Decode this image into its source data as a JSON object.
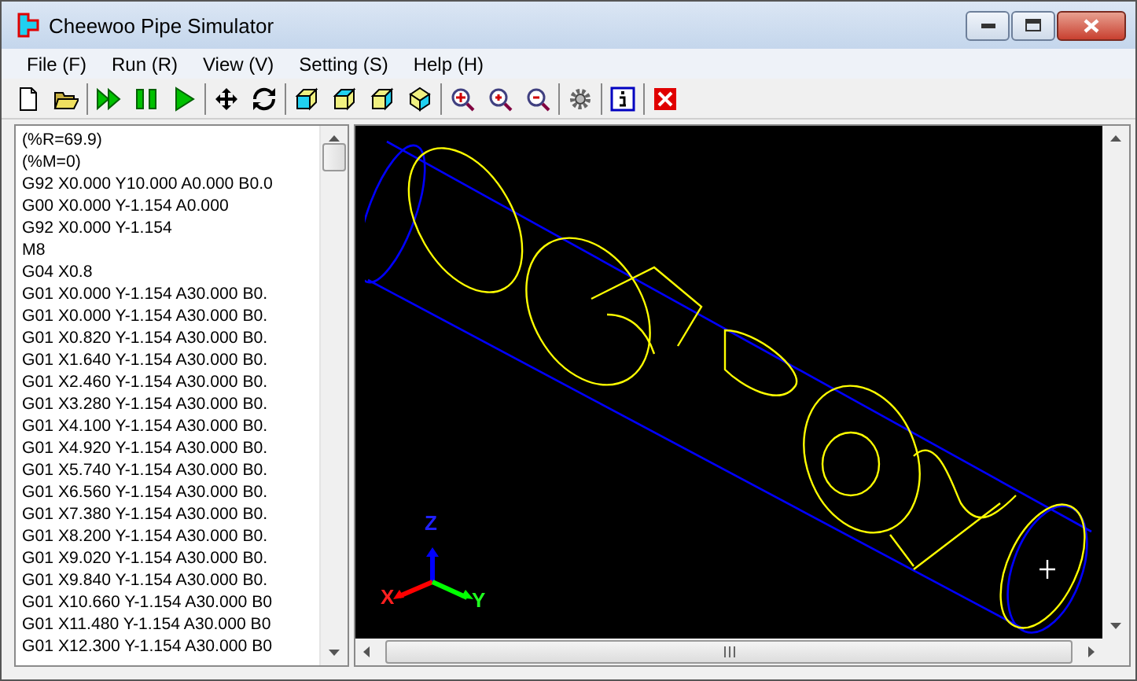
{
  "window": {
    "title": "Cheewoo Pipe Simulator"
  },
  "menu": [
    "File (F)",
    "Run (R)",
    "View (V)",
    "Setting (S)",
    "Help (H)"
  ],
  "code_lines": [
    "(%R=69.9)",
    "(%M=0)",
    "G92 X0.000 Y10.000 A0.000 B0.0",
    "G00 X0.000 Y-1.154 A0.000",
    "G92 X0.000 Y-1.154",
    "M8",
    "G04 X0.8",
    "G01 X0.000 Y-1.154 A30.000 B0.",
    "G01 X0.000 Y-1.154 A30.000 B0.",
    "G01 X0.820 Y-1.154 A30.000 B0.",
    "G01 X1.640 Y-1.154 A30.000 B0.",
    "G01 X2.460 Y-1.154 A30.000 B0.",
    "G01 X3.280 Y-1.154 A30.000 B0.",
    "G01 X4.100 Y-1.154 A30.000 B0.",
    "G01 X4.920 Y-1.154 A30.000 B0.",
    "G01 X5.740 Y-1.154 A30.000 B0.",
    "G01 X6.560 Y-1.154 A30.000 B0.",
    "G01 X7.380 Y-1.154 A30.000 B0.",
    "G01 X8.200 Y-1.154 A30.000 B0.",
    "G01 X9.020 Y-1.154 A30.000 B0.",
    "G01 X9.840 Y-1.154 A30.000 B0.",
    "G01 X10.660 Y-1.154 A30.000 B0",
    "G01 X11.480 Y-1.154 A30.000 B0",
    "G01 X12.300 Y-1.154 A30.000 B0"
  ],
  "axes": {
    "z": "Z",
    "x": "X",
    "y": "Y"
  }
}
